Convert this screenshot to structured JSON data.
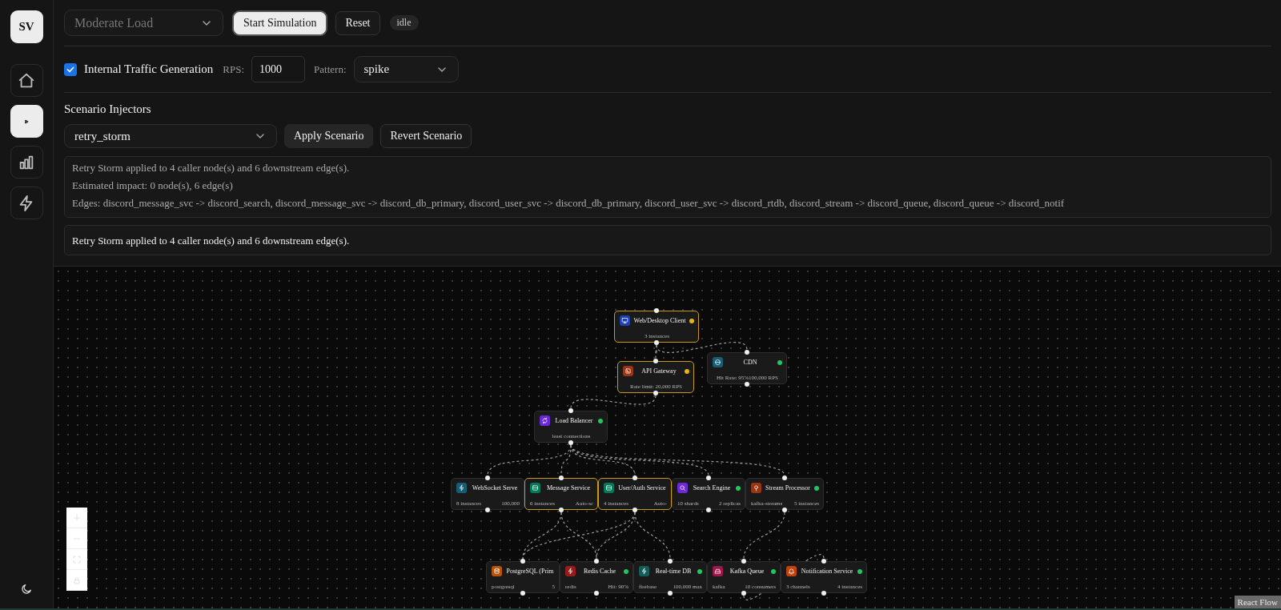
{
  "sidebar": {
    "logo": "SV",
    "items": [
      {
        "kind": "home",
        "selected": false
      },
      {
        "kind": "play",
        "selected": true
      },
      {
        "kind": "chart",
        "selected": false
      },
      {
        "kind": "bolt",
        "selected": false
      }
    ],
    "theme_toggle": {
      "kind": "moon"
    }
  },
  "toolbar": {
    "load_select": {
      "value": "Moderate Load",
      "disabled": true
    },
    "buttons": [
      {
        "label": "Start Simulation",
        "kind": "primary"
      },
      {
        "label": "Reset",
        "kind": "secondary"
      }
    ],
    "status": "idle"
  },
  "traffic": {
    "enabled": true,
    "label": "Internal Traffic Generation",
    "rps_label": "RPS:",
    "rps_value": "1000",
    "pattern_label": "Pattern:",
    "pattern_value": "spike"
  },
  "scenarios": {
    "heading": "Scenario Injectors",
    "select_value": "retry_storm",
    "buttons": [
      "Apply Scenario",
      "Revert Scenario"
    ],
    "details": [
      "Retry Storm applied to 4 caller node(s) and 6 downstream edge(s).",
      "Estimated impact: 0 node(s), 6 edge(s)",
      "Edges: discord_message_svc -> discord_search, discord_message_svc -> discord_db_primary, discord_user_svc -> discord_db_primary, discord_user_svc -> discord_rtdb, discord_stream -> discord_queue, discord_queue -> discord_notif"
    ],
    "message": "Retry Storm applied to 4 caller node(s) and 6 downstream edge(s)."
  },
  "diagram": {
    "nodes": [
      {
        "kind": "client",
        "title": "Web/Desktop Client",
        "details": [
          "3 instances"
        ],
        "affected": true,
        "color": "#eab308"
      },
      {
        "kind": "cdn",
        "title": "CDN",
        "details": [
          "Hit Rate: 95%100,000 RPS"
        ],
        "affected": false,
        "color": "#22c55e"
      },
      {
        "kind": "gateway",
        "title": "API Gateway",
        "details": [
          "Rate limit: 20,000 RPS"
        ],
        "affected": true,
        "color": "#eab308"
      },
      {
        "kind": "balancer",
        "title": "Load Balancer",
        "details": [
          "least connections"
        ],
        "affected": false,
        "color": "#22c55e"
      },
      {
        "kind": "websocket",
        "title": "WebSocket Serve",
        "details": [
          "8 instances",
          "100,000"
        ],
        "affected": false
      },
      {
        "kind": "service",
        "title": "Message Service",
        "details": [
          "6 instances",
          "Auto-sc"
        ],
        "affected": true
      },
      {
        "kind": "service",
        "title": "User/Auth Service",
        "details": [
          "4 instances",
          "Auto-"
        ],
        "affected": true
      },
      {
        "kind": "search",
        "title": "Search Engine",
        "details": [
          "10 shards",
          "2 replicas"
        ],
        "affected": false,
        "color": "#22c55e"
      },
      {
        "kind": "stream",
        "title": "Stream Processor",
        "details": [
          "kafka-streams",
          "5 instances"
        ],
        "affected": false,
        "color": "#22c55e"
      },
      {
        "kind": "database",
        "title": "PostgreSQL (Prim",
        "details": [
          "postgresql",
          "5"
        ],
        "affected": false
      },
      {
        "kind": "cache",
        "title": "Redis Cache",
        "details": [
          "redis",
          "Hit: 90%"
        ],
        "affected": false,
        "color": "#22c55e"
      },
      {
        "kind": "realtime",
        "title": "Real-time DB",
        "details": [
          "firebase",
          "100,000 max"
        ],
        "affected": false,
        "color": "#22c55e"
      },
      {
        "kind": "queue",
        "title": "Kafka Queue",
        "details": [
          "kafka",
          "10 consumers"
        ],
        "affected": false,
        "color": "#22c55e"
      },
      {
        "kind": "notification",
        "title": "Notification Service",
        "details": [
          "3 channels",
          "4 instances"
        ],
        "affected": false,
        "color": "#22c55e"
      }
    ],
    "attribution": "React Flow"
  }
}
